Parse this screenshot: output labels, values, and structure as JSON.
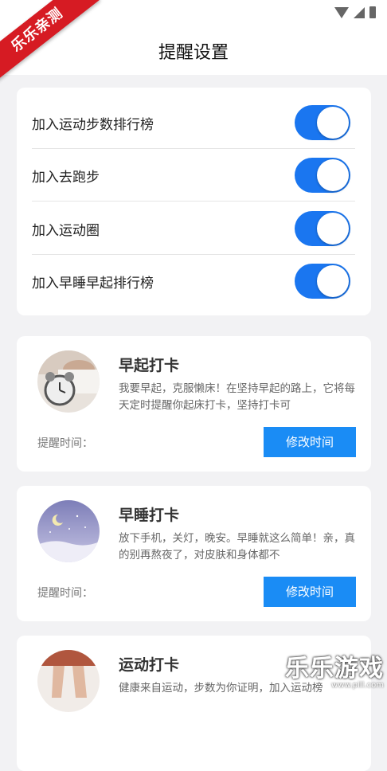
{
  "watermark_ribbon": "乐乐亲测",
  "header": {
    "title": "提醒设置"
  },
  "settings": [
    {
      "label": "加入运动步数排行榜",
      "on": true
    },
    {
      "label": "加入去跑步",
      "on": true
    },
    {
      "label": "加入运动圈",
      "on": true
    },
    {
      "label": "加入早睡早起排行榜",
      "on": true
    }
  ],
  "reminders": [
    {
      "title": "早起打卡",
      "desc": "我要早起，克服懒床！在坚持早起的路上，它将每天定时提醒你起床打卡，坚持打卡可",
      "time_label": "提醒时间：",
      "button": "修改时间"
    },
    {
      "title": "早睡打卡",
      "desc": "放下手机，关灯，晚安。早睡就这么简单！亲，真的别再熬夜了，对皮肤和身体都不",
      "time_label": "提醒时间：",
      "button": "修改时间"
    },
    {
      "title": "运动打卡",
      "desc": "健康来自运动，步数为你证明，加入运动榜",
      "time_label": "",
      "button": ""
    }
  ],
  "watermark": {
    "main": "乐乐游戏",
    "url": "www.pill.com"
  },
  "colors": {
    "accent": "#1a76f0",
    "button": "#1a8cf5",
    "ribbon": "#d61b23"
  }
}
